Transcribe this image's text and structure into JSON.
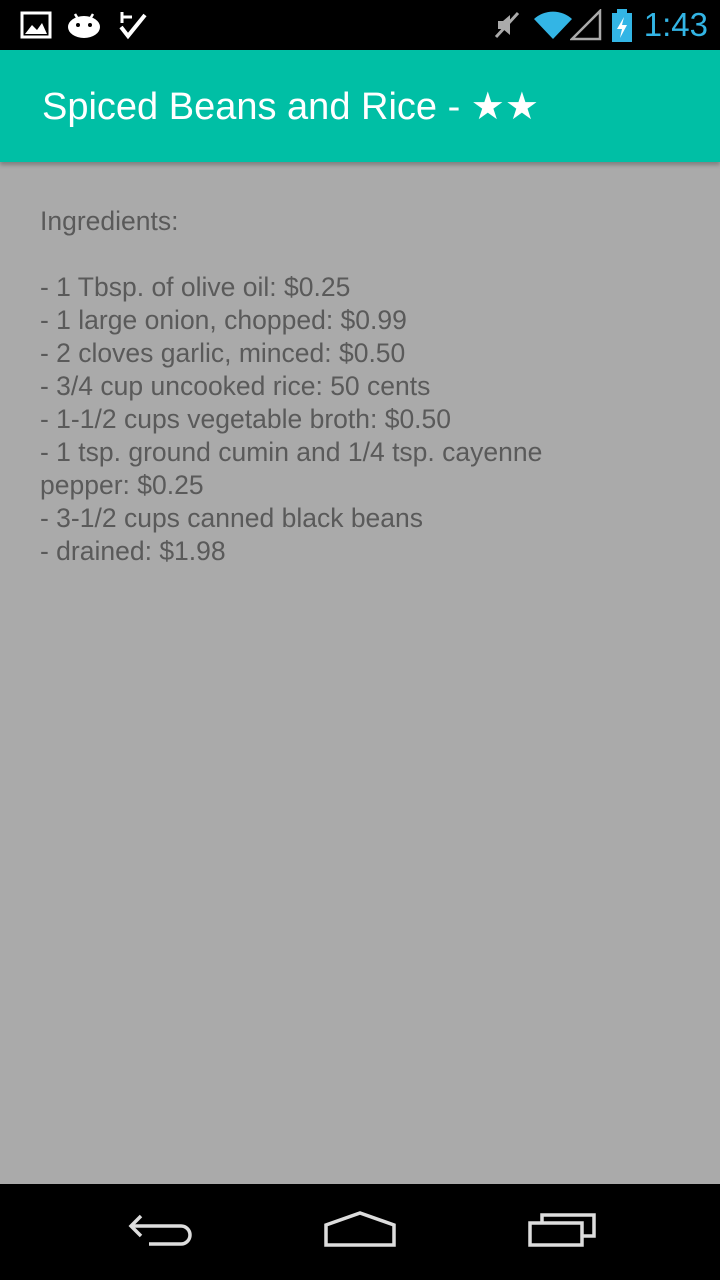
{
  "status_bar": {
    "time": "1:43",
    "left_icons": [
      "gallery-icon",
      "android-icon",
      "checklist-icon"
    ],
    "right_icons": [
      "muted-icon",
      "wifi-icon",
      "signal-icon",
      "battery-charging-icon"
    ]
  },
  "app_bar": {
    "title": "Spiced Beans and Rice - ★★"
  },
  "recipe": {
    "heading": "Ingredients:",
    "lines": [
      "- 1 Tbsp. of olive oil: $0.25",
      "- 1 large onion, chopped: $0.99",
      "- 2 cloves garlic, minced: $0.50",
      "- 3/4 cup uncooked rice: 50 cents",
      "- 1-1/2 cups vegetable broth: $0.50",
      "- 1 tsp. ground cumin and 1/4 tsp. cayenne pepper: $0.25",
      "- 3-1/2 cups canned black beans",
      "- drained: $1.98"
    ]
  },
  "nav_bar": {
    "icons": [
      "back-icon",
      "home-icon",
      "recent-apps-icon"
    ]
  },
  "colors": {
    "accent": "#00bfa5",
    "background": "#aaaaaa",
    "text": "#5a5a5a",
    "clock": "#33b5e5"
  }
}
